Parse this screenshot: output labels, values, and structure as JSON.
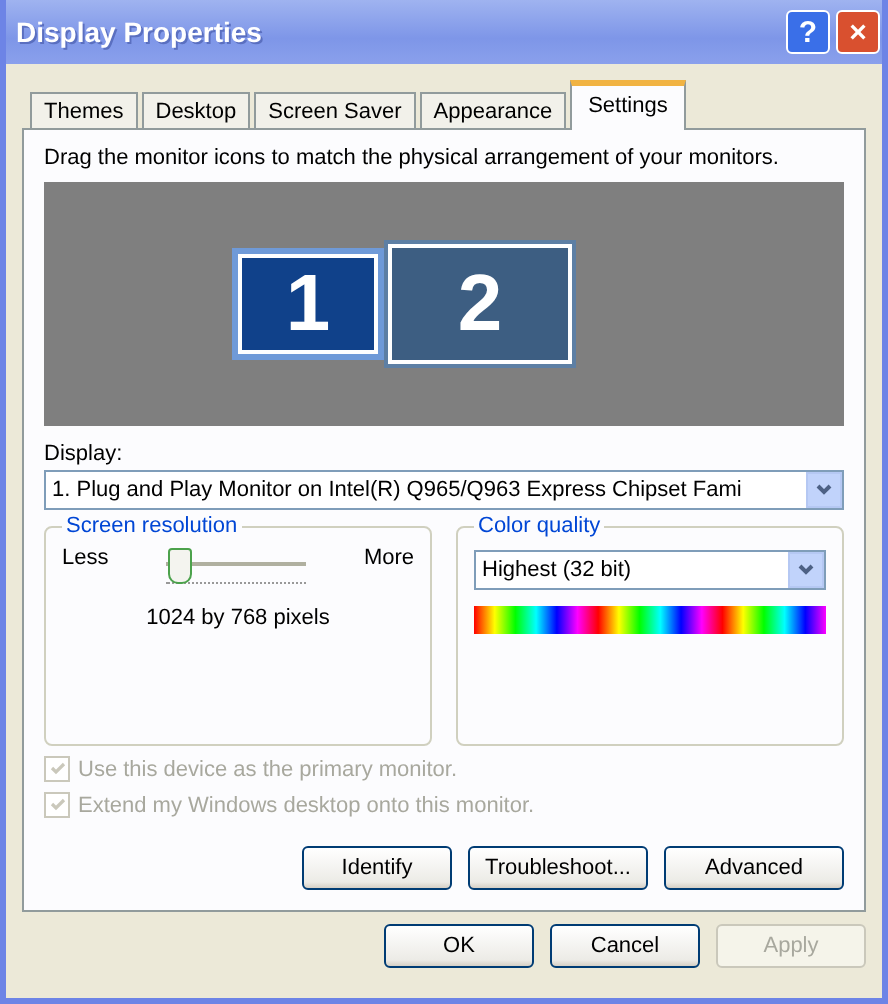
{
  "window": {
    "title": "Display Properties",
    "help": "?",
    "close": "×"
  },
  "tabs": [
    {
      "label": "Themes",
      "selected": false
    },
    {
      "label": "Desktop",
      "selected": false
    },
    {
      "label": "Screen Saver",
      "selected": false
    },
    {
      "label": "Appearance",
      "selected": false
    },
    {
      "label": "Settings",
      "selected": true
    }
  ],
  "instructions": "Drag the monitor icons to match the physical arrangement of your monitors.",
  "monitors": [
    {
      "label": "1",
      "selected": true
    },
    {
      "label": "2",
      "selected": false
    }
  ],
  "display": {
    "label": "Display:",
    "value": "1. Plug and Play Monitor on Intel(R)  Q965/Q963 Express Chipset Fami"
  },
  "resolution": {
    "title": "Screen resolution",
    "less": "Less",
    "more": "More",
    "level": 0.08,
    "reading": "1024 by 768 pixels"
  },
  "color_quality": {
    "title": "Color quality",
    "value": "Highest (32 bit)"
  },
  "options": [
    {
      "label": "Use this device as the primary monitor.",
      "checked": true,
      "disabled": true
    },
    {
      "label": "Extend my Windows desktop onto this monitor.",
      "checked": true,
      "disabled": true
    }
  ],
  "panel_buttons": [
    "Identify",
    "Troubleshoot...",
    "Advanced"
  ],
  "dialog_buttons": [
    {
      "label": "OK",
      "disabled": false
    },
    {
      "label": "Cancel",
      "disabled": false
    },
    {
      "label": "Apply",
      "disabled": true
    }
  ]
}
